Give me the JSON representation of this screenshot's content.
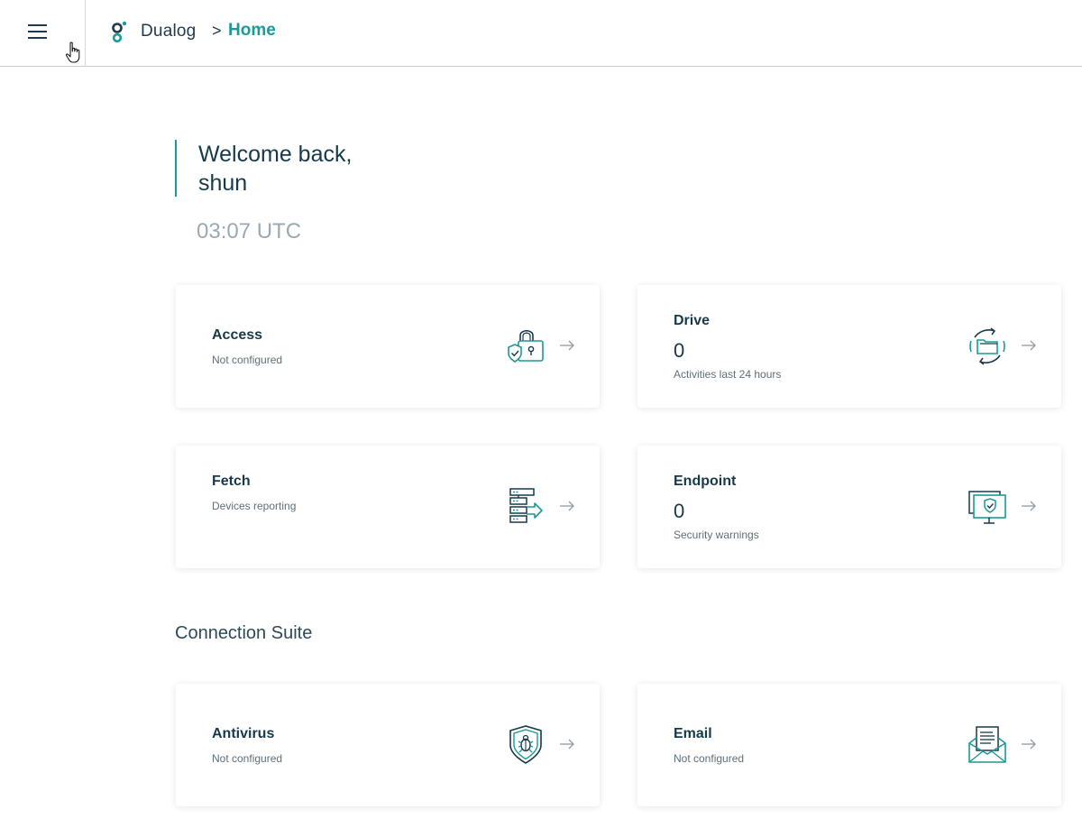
{
  "header": {
    "brand": "Dualog",
    "separator": ">",
    "current_page": "Home"
  },
  "welcome": {
    "line1": "Welcome back,",
    "line2": "shun",
    "time": "03:07 UTC"
  },
  "cards": {
    "access": {
      "title": "Access",
      "subtitle": "Not configured",
      "icon": "lock-shield-icon"
    },
    "drive": {
      "title": "Drive",
      "value": "0",
      "subtitle": "Activities last 24 hours",
      "icon": "folder-sync-icon"
    },
    "fetch": {
      "title": "Fetch",
      "subtitle": "Devices reporting",
      "icon": "server-transfer-icon"
    },
    "endpoint": {
      "title": "Endpoint",
      "value": "0",
      "subtitle": "Security warnings",
      "icon": "monitor-shield-icon"
    },
    "antivirus": {
      "title": "Antivirus",
      "subtitle": "Not configured",
      "icon": "shield-bug-icon"
    },
    "email": {
      "title": "Email",
      "subtitle": "Not configured",
      "icon": "envelope-letter-icon"
    }
  },
  "sections": {
    "connection_suite": "Connection Suite"
  },
  "colors": {
    "accent": "#1b9a98",
    "text_dark": "#173a4b",
    "text_muted": "#5f6f78",
    "time_gray": "#9aaab3"
  }
}
